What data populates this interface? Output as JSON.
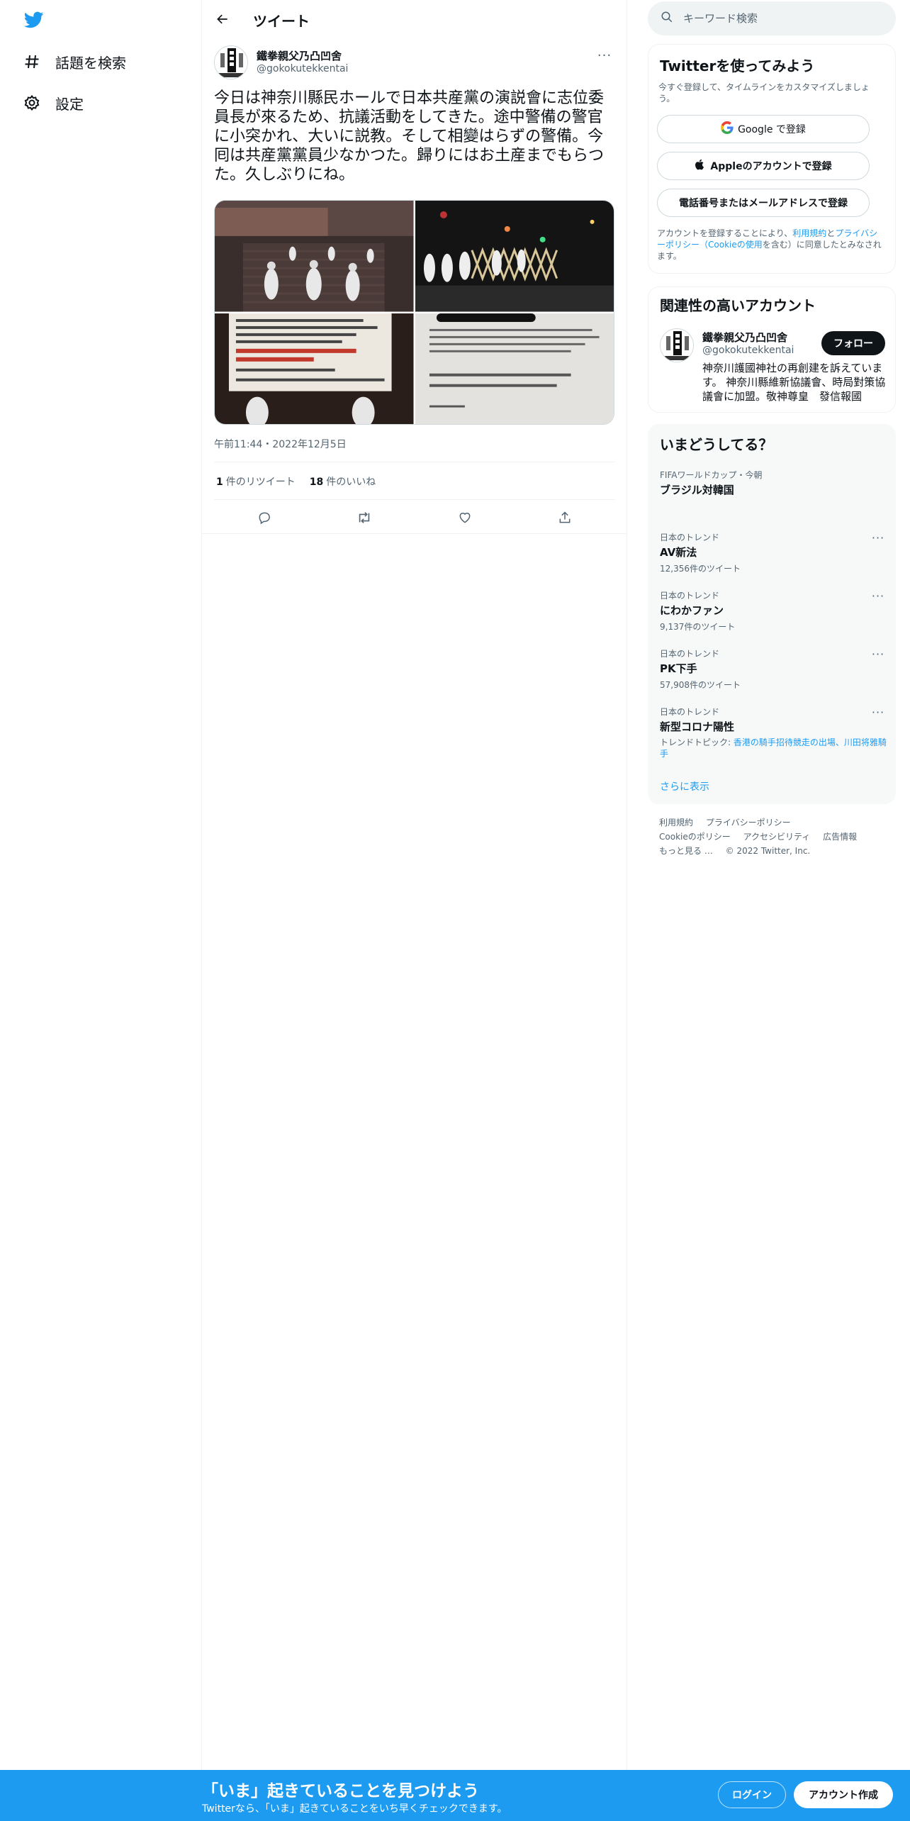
{
  "colors": {
    "brand": "#1d9bf0",
    "text": "#0f1419",
    "secondary": "#536471",
    "border": "#eff3f4"
  },
  "nav": {
    "logo_icon": "twitter-bird-icon",
    "items": [
      {
        "label": "話題を検索",
        "icon": "hashtag-icon"
      },
      {
        "label": "設定",
        "icon": "gear-icon"
      }
    ]
  },
  "header": {
    "title": "ツイート"
  },
  "tweet": {
    "author_name": "鐵拳親父乃凸凹舍",
    "author_handle": "@gokokutekkentai",
    "text": "今日は神奈川縣民ホールで日本共産黨の演説會に志位委員長が來るため、抗議活動をしてきた。途中警備の警官に小突かれ、大いに説教。そして相變はらずの警備。今囘は共産黨黨員少なかつた。歸りにはお土産までもらつた。久しぶりにね。",
    "timestamp": "午前11:44・2022年12月5日",
    "retweets": {
      "count": "1",
      "label": "件のリツイート"
    },
    "likes": {
      "count": "18",
      "label": "件のいいね"
    },
    "actions": [
      "reply-icon",
      "retweet-icon",
      "like-icon",
      "share-icon"
    ]
  },
  "search": {
    "placeholder": "キーワード検索"
  },
  "signup_card": {
    "title": "Twitterを使ってみよう",
    "subtitle": "今すぐ登録して、タイムラインをカスタマイズしましょう。",
    "google": "Google で登録",
    "apple": "Appleのアカウントで登録",
    "phone": "電話番号またはメールアドレスで登録",
    "terms_pre": "アカウントを登録することにより、",
    "terms_link": "利用規約",
    "terms_mid": "と",
    "privacy_link": "プライバシーポリシー（Cookieの使用",
    "terms_post": "を含む）に同意したとみなされます。"
  },
  "relevant": {
    "title": "関連性の高いアカウント",
    "name": "鐵拳親父乃凸凹舍",
    "handle": "@gokokutekkentai",
    "follow": "フォロー",
    "bio": "神奈川護國神社の再創建を訴えています。 神奈川縣維新協議會、時局對策協議會に加盟。敬神尊皇　發信報國"
  },
  "trends": {
    "title": "いまどうしてる？",
    "items": [
      {
        "category": "FIFAワールドカップ・今朝",
        "name": "ブラジル対韓国",
        "count": ""
      },
      {
        "category": "日本のトレンド",
        "name": "AV新法",
        "count": "12,356件のツイート"
      },
      {
        "category": "日本のトレンド",
        "name": "にわかファン",
        "count": "9,137件のツイート"
      },
      {
        "category": "日本のトレンド",
        "name": "PK下手",
        "count": "57,908件のツイート"
      },
      {
        "category": "日本のトレンド",
        "name": "新型コロナ陽性",
        "count": ""
      }
    ],
    "topic_label": "トレンドトピック: ",
    "topic_link": "香港の騎手招待競走の出場、川田将雅騎手",
    "show_more": "さらに表示"
  },
  "footer": {
    "terms": "利用規約",
    "privacy": "プライバシーポリシー",
    "cookies": "Cookieのポリシー",
    "accessibility": "アクセシビリティ",
    "ads": "広告情報",
    "more": "もっと見る …",
    "copyright": "© 2022 Twitter, Inc."
  },
  "banner": {
    "title": "「いま」起きていることを見つけよう",
    "subtitle": "Twitterなら、「いま」起きていることをいち早くチェックできます。",
    "login": "ログイン",
    "signup": "アカウント作成"
  }
}
